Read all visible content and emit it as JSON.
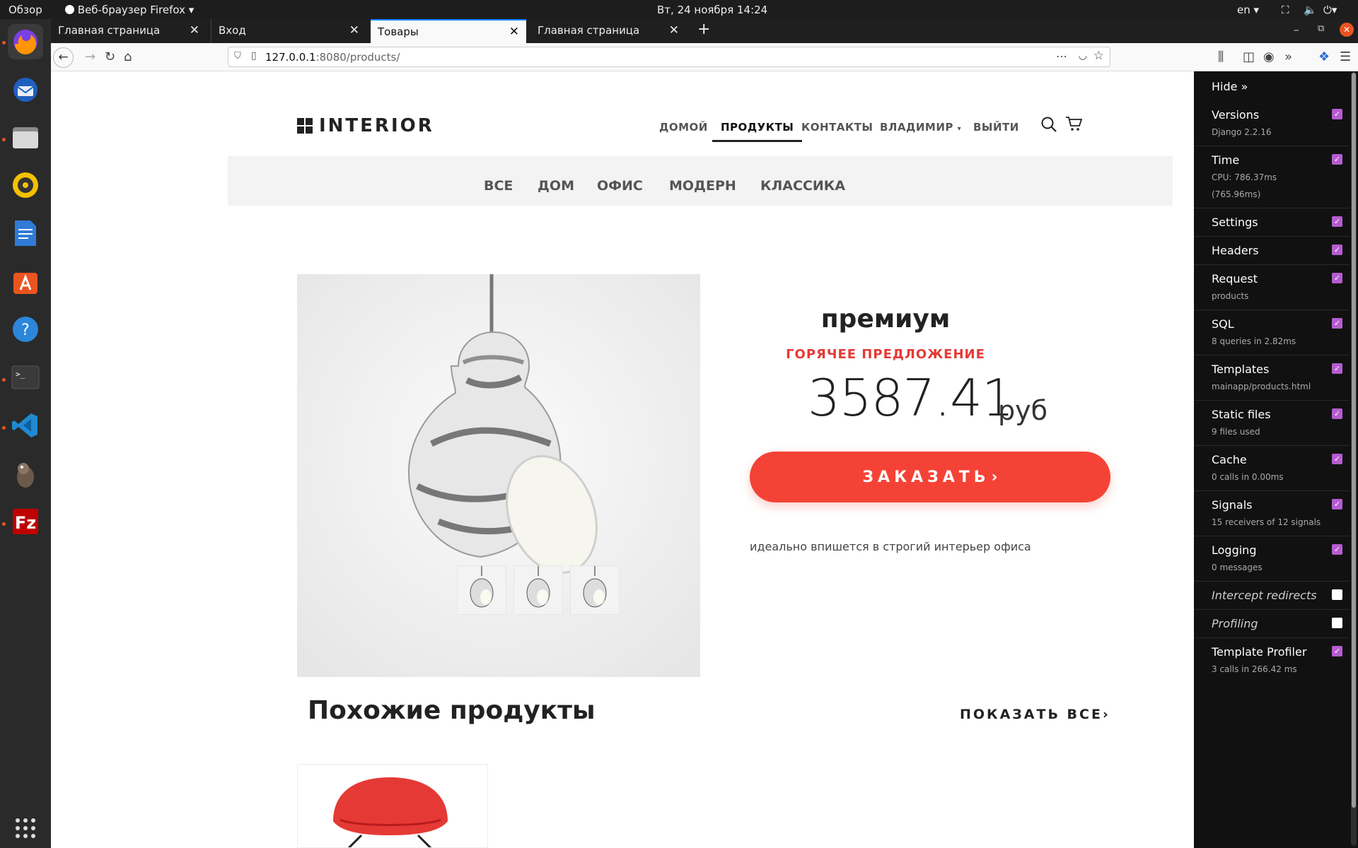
{
  "topbar": {
    "overview": "Обзор",
    "app_menu": "Веб-браузер Firefox",
    "datetime": "Вт, 24 ноября  14:24",
    "lang": "en"
  },
  "dock": {
    "apps": [
      "firefox-icon",
      "thunderbird-icon",
      "files-icon",
      "rhythmbox-icon",
      "writer-icon",
      "software-icon",
      "help-icon",
      "terminal-icon",
      "vscode-icon",
      "gimp-icon",
      "filezilla-icon"
    ],
    "show_apps": "grid-icon"
  },
  "tabs": [
    {
      "label": "Главная страница"
    },
    {
      "label": "Вход"
    },
    {
      "label": "Товары"
    },
    {
      "label": "Главная страница"
    }
  ],
  "url": {
    "host": "127.0.0.1",
    "rest": ":8080/products/"
  },
  "site": {
    "logo": "INTERIOR",
    "nav": {
      "home": "ДОМОЙ",
      "products": "ПРОДУКТЫ",
      "contacts": "КОНТАКТЫ",
      "user": "ВЛАДИМИР",
      "logout": "ВЫЙТИ"
    },
    "categories": [
      "ВСЕ",
      "ДОМ",
      "ОФИС",
      "МОДЕРН",
      "КЛАССИКА"
    ],
    "product": {
      "title": "премиум",
      "badge": "ГОРЯЧЕЕ ПРЕДЛОЖЕНИЕ",
      "price": "3587.41",
      "currency": "руб",
      "order_label": "ЗАКАЗАТЬ",
      "description": "идеально впишется в строгий интерьер офиса"
    },
    "similar_title": "Похожие продукты",
    "show_all": "ПОКАЗАТЬ ВСЕ",
    "accent": "#f44336"
  },
  "djdt": {
    "hide": "Hide »",
    "panels": [
      {
        "title": "Versions",
        "sub": "Django 2.2.16",
        "checked": true
      },
      {
        "title": "Time",
        "sub": "CPU: 786.37ms",
        "sub2": "(765.96ms)",
        "checked": true
      },
      {
        "title": "Settings",
        "sub": "",
        "checked": true
      },
      {
        "title": "Headers",
        "sub": "",
        "checked": true
      },
      {
        "title": "Request",
        "sub": "products",
        "checked": true
      },
      {
        "title": "SQL",
        "sub": "8 queries in 2.82ms",
        "checked": true
      },
      {
        "title": "Templates",
        "sub": "mainapp/products.html",
        "checked": true
      },
      {
        "title": "Static files",
        "sub": "9 files used",
        "checked": true
      },
      {
        "title": "Cache",
        "sub": "0 calls in 0.00ms",
        "checked": true
      },
      {
        "title": "Signals",
        "sub": "15 receivers of 12 signals",
        "checked": true
      },
      {
        "title": "Logging",
        "sub": "0 messages",
        "checked": true
      },
      {
        "title": "Intercept redirects",
        "sub": "",
        "checked": false
      },
      {
        "title": "Profiling",
        "sub": "",
        "checked": false
      },
      {
        "title": "Template Profiler",
        "sub": "3 calls in 266.42 ms",
        "checked": true
      }
    ]
  }
}
